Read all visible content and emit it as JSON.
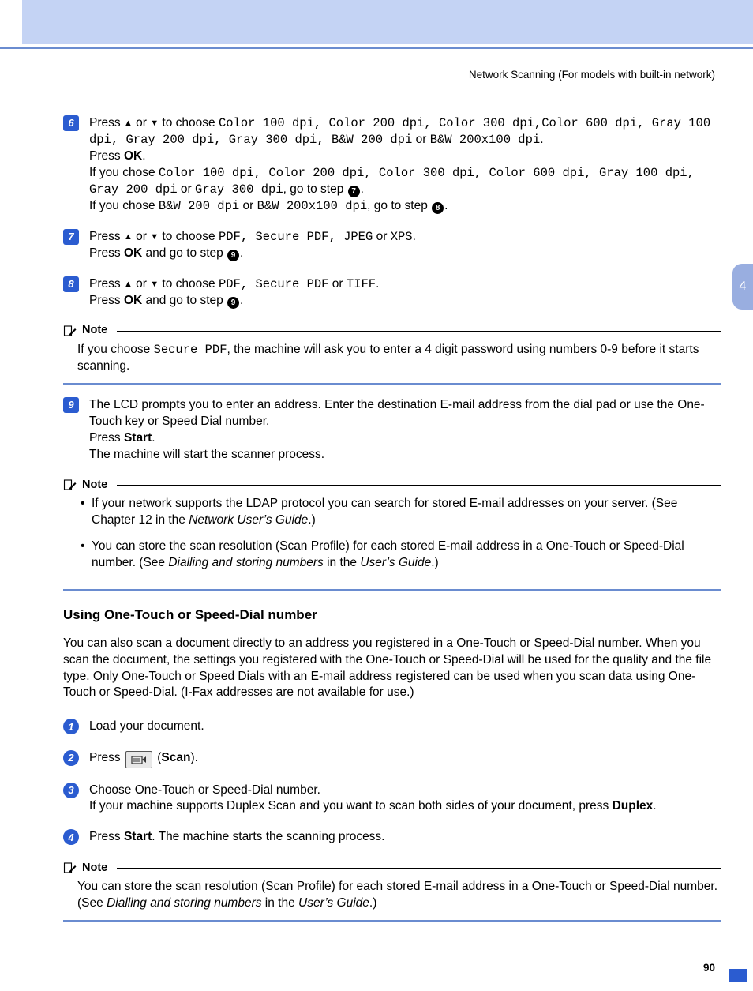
{
  "header": "Network Scanning (For models with built-in network)",
  "side_tab": "4",
  "step6": {
    "pre": "Press ",
    "mid": " to choose ",
    "opts": "Color 100 dpi, Color 200 dpi, Color 300 dpi,Color 600 dpi, Gray 100 dpi, Gray 200 dpi, Gray 300 dpi, B&W 200 dpi",
    "or": " or ",
    "last": "B&W 200x100 dpi",
    "dot": ".",
    "press": "Press ",
    "ok": "OK",
    "line3a": "If you chose ",
    "line3b": "Color 100 dpi, Color 200 dpi, Color 300 dpi, Color 600 dpi, Gray 100 dpi, Gray 200 dpi",
    "line3c": "Gray 300 dpi",
    "goto": ", go to step ",
    "line4a": "If you chose ",
    "line4b": "B&W 200 dpi",
    "line4c": "B&W 200x100 dpi"
  },
  "step7": {
    "opts": "PDF, Secure PDF, JPEG",
    "last": "XPS",
    "press": "Press ",
    "ok": "OK",
    "and": " and go to step "
  },
  "step8": {
    "opts": "PDF, Secure PDF",
    "last": "TIFF"
  },
  "note1": {
    "title": "Note",
    "a": "If you choose ",
    "b": "Secure PDF",
    "c": ", the machine will ask you to enter a 4 digit password using numbers 0-9 before it starts scanning."
  },
  "step9": {
    "l1": "The LCD prompts you to enter an address. Enter the destination E-mail address from the dial pad or use the One-Touch key or Speed Dial number.",
    "l2a": "Press ",
    "l2b": "Start",
    "l3": "The machine will start the scanner process."
  },
  "note2": {
    "title": "Note",
    "li1a": "If your network supports the LDAP protocol you can search for stored E-mail addresses on your server. (See Chapter 12 in the ",
    "li1b": "Network User’s Guide",
    "li1c": ".)",
    "li2a": "You can store the scan resolution (Scan Profile) for each stored E-mail address in a One-Touch or Speed-Dial number. (See ",
    "li2b": "Dialling and storing numbers",
    "li2c": " in the ",
    "li2d": "User’s Guide",
    "li2e": ".)"
  },
  "section_title": "Using One-Touch or Speed-Dial number",
  "section_para": "You can also scan a document directly to an address you registered in a One-Touch or Speed-Dial number. When you scan the document, the settings you registered with the One-Touch or Speed-Dial will be used for the quality and the file type. Only One-Touch or Speed Dials with an E-mail address registered can be used when you scan data using One-Touch or Speed-Dial. (I-Fax addresses are not available for use.)",
  "s2_step1": "Load your document.",
  "s2_step2": {
    "a": "Press ",
    "b": " (",
    "c": "Scan",
    "d": ")."
  },
  "s2_step3": {
    "l1": "Choose One-Touch or Speed-Dial number.",
    "l2a": "If your machine supports Duplex Scan and you want to scan both sides of your document, press ",
    "l2b": "Duplex",
    "l2c": "."
  },
  "s2_step4": {
    "a": "Press ",
    "b": "Start",
    "c": ". The machine starts the scanning process."
  },
  "note3": {
    "title": "Note",
    "a": "You can store the scan resolution (Scan Profile) for each stored E-mail address in a One-Touch or Speed-Dial number. (See ",
    "b": "Dialling and storing numbers",
    "c": " in the ",
    "d": "User’s Guide",
    "e": ".)"
  },
  "page_number": "90",
  "arrows": {
    "up": "▲",
    "down": "▼",
    "or": " or "
  },
  "steps_ref": {
    "s7": "7",
    "s8": "8",
    "s9": "9"
  }
}
